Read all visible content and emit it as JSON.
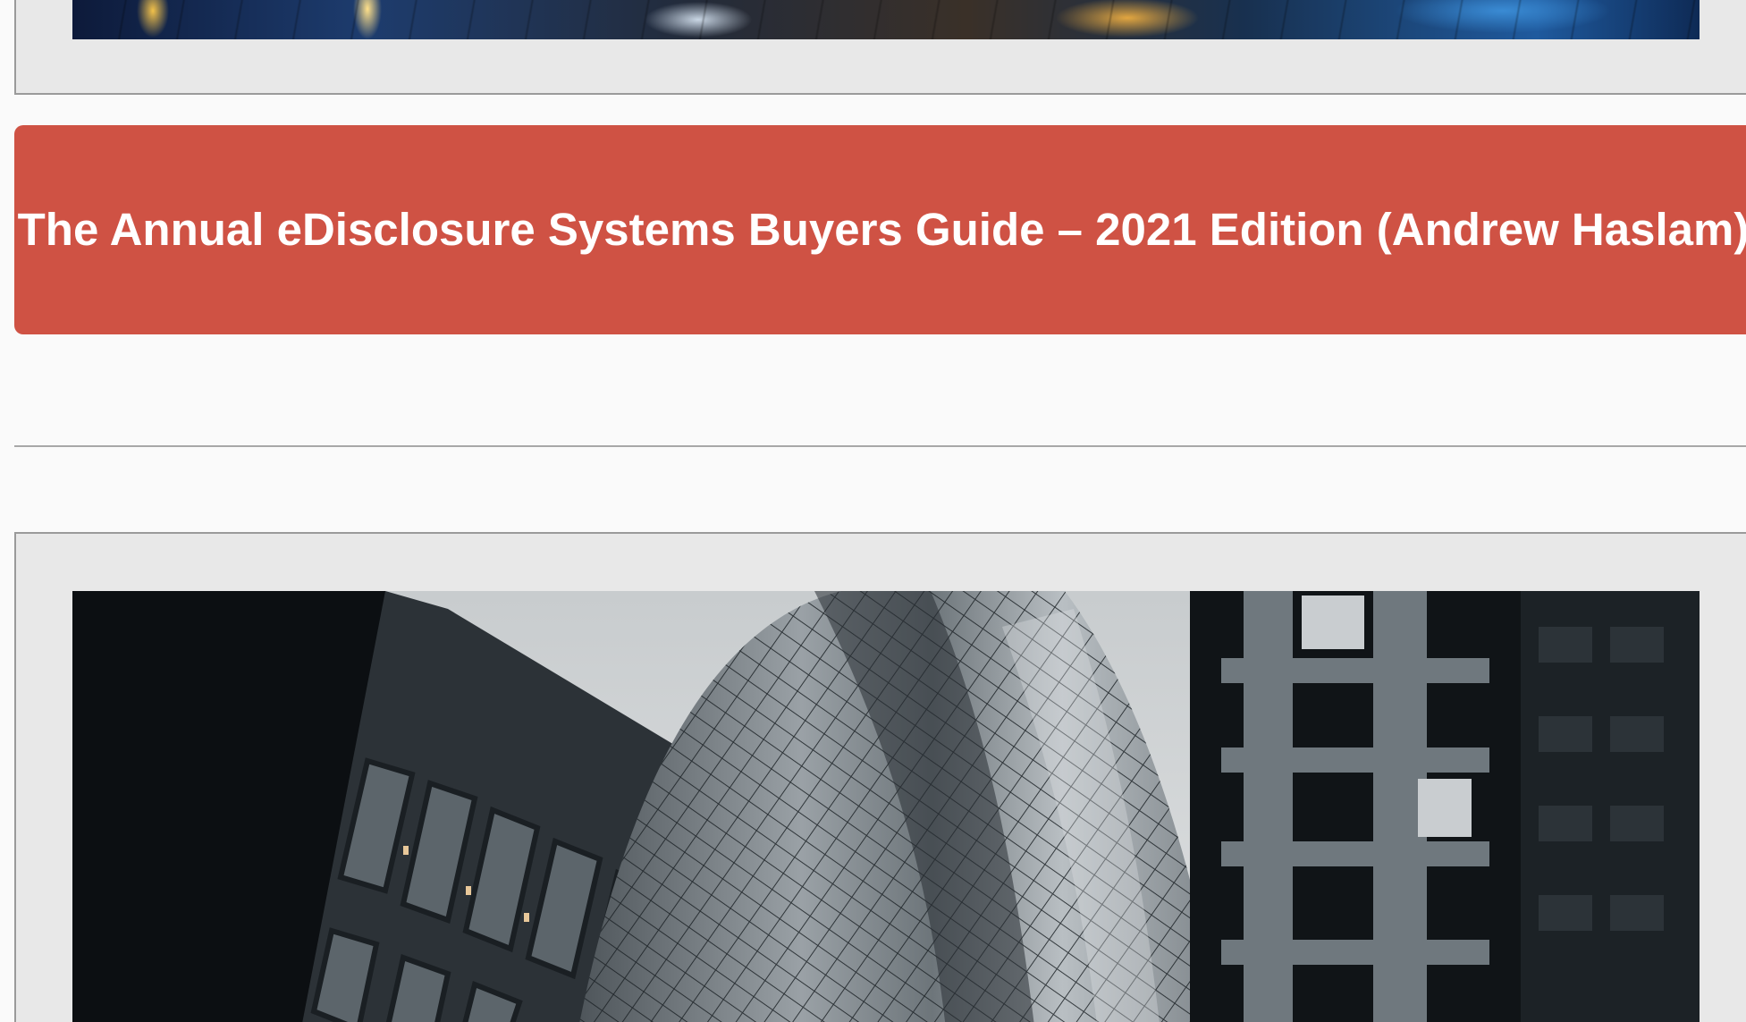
{
  "banner": {
    "title": "The Annual eDisclosure Systems Buyers Guide – 2021 Edition (Andrew Haslam)"
  },
  "colors": {
    "banner_background": "#cf5244",
    "banner_text": "#ffffff",
    "card_background": "#e8e8e8",
    "page_background": "#fafafa"
  }
}
